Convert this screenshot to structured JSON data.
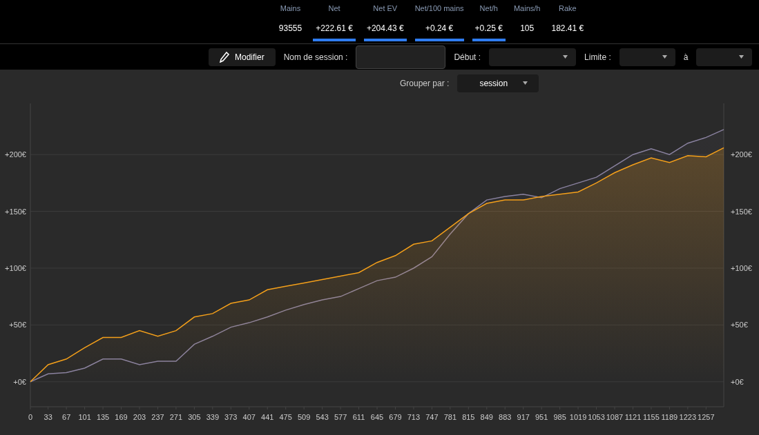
{
  "stats": [
    {
      "label": "Mains",
      "value": "93555",
      "underlined": false
    },
    {
      "label": "Net",
      "value": "+222.61 €",
      "underlined": true
    },
    {
      "label": "Net EV",
      "value": "+204.43 €",
      "underlined": true
    },
    {
      "label": "Net/100 mains",
      "value": "+0.24 €",
      "underlined": true
    },
    {
      "label": "Net/h",
      "value": "+0.25 €",
      "underlined": true
    },
    {
      "label": "Mains/h",
      "value": "105",
      "underlined": false
    },
    {
      "label": "Rake",
      "value": "182.41 €",
      "underlined": false
    }
  ],
  "toolbar": {
    "edit_button": "Modifier",
    "session_name_label": "Nom de session :",
    "start_label": "Début :",
    "limit_label": "Limite :",
    "to_label": "à"
  },
  "group_by": {
    "label": "Grouper par :",
    "value": "session"
  },
  "chart": {
    "chart_data": {
      "type": "area",
      "xlim": [
        0,
        1290
      ],
      "ylim": [
        -22,
        245
      ],
      "grid": true,
      "x": [
        0,
        33,
        67,
        101,
        135,
        169,
        203,
        237,
        271,
        305,
        339,
        373,
        407,
        441,
        475,
        509,
        543,
        577,
        611,
        645,
        679,
        713,
        747,
        781,
        815,
        849,
        883,
        917,
        951,
        985,
        1019,
        1053,
        1087,
        1121,
        1155,
        1189,
        1223,
        1257,
        1290
      ],
      "xticks": [
        0,
        33,
        67,
        101,
        135,
        169,
        203,
        237,
        271,
        305,
        339,
        373,
        407,
        441,
        475,
        509,
        543,
        577,
        611,
        645,
        679,
        713,
        747,
        781,
        815,
        849,
        883,
        917,
        951,
        985,
        1019,
        1053,
        1087,
        1121,
        1155,
        1189,
        1223,
        1257
      ],
      "yticks": [
        {
          "value": 0,
          "label": "+0€"
        },
        {
          "value": 50,
          "label": "+50€"
        },
        {
          "value": 100,
          "label": "+100€"
        },
        {
          "value": 150,
          "label": "+150€"
        },
        {
          "value": 200,
          "label": "+200€"
        }
      ],
      "series": [
        {
          "color": "#8a82a0",
          "values": [
            0,
            7,
            8,
            12,
            20,
            20,
            15,
            18,
            18,
            33,
            40,
            48,
            52,
            57,
            63,
            68,
            72,
            75,
            82,
            89,
            92,
            100,
            110,
            130,
            148,
            160,
            163,
            165,
            162,
            170,
            175,
            180,
            190,
            200,
            205,
            200,
            210,
            215,
            222
          ]
        },
        {
          "color": "#f5a01a",
          "values": [
            0,
            15,
            20,
            30,
            39,
            39,
            45,
            40,
            45,
            57,
            60,
            69,
            72,
            81,
            84,
            87,
            90,
            93,
            96,
            105,
            111,
            121,
            124,
            136,
            148,
            157,
            160,
            160,
            163,
            165,
            167,
            175,
            184,
            191,
            197,
            193,
            199,
            198,
            206
          ]
        }
      ]
    }
  }
}
